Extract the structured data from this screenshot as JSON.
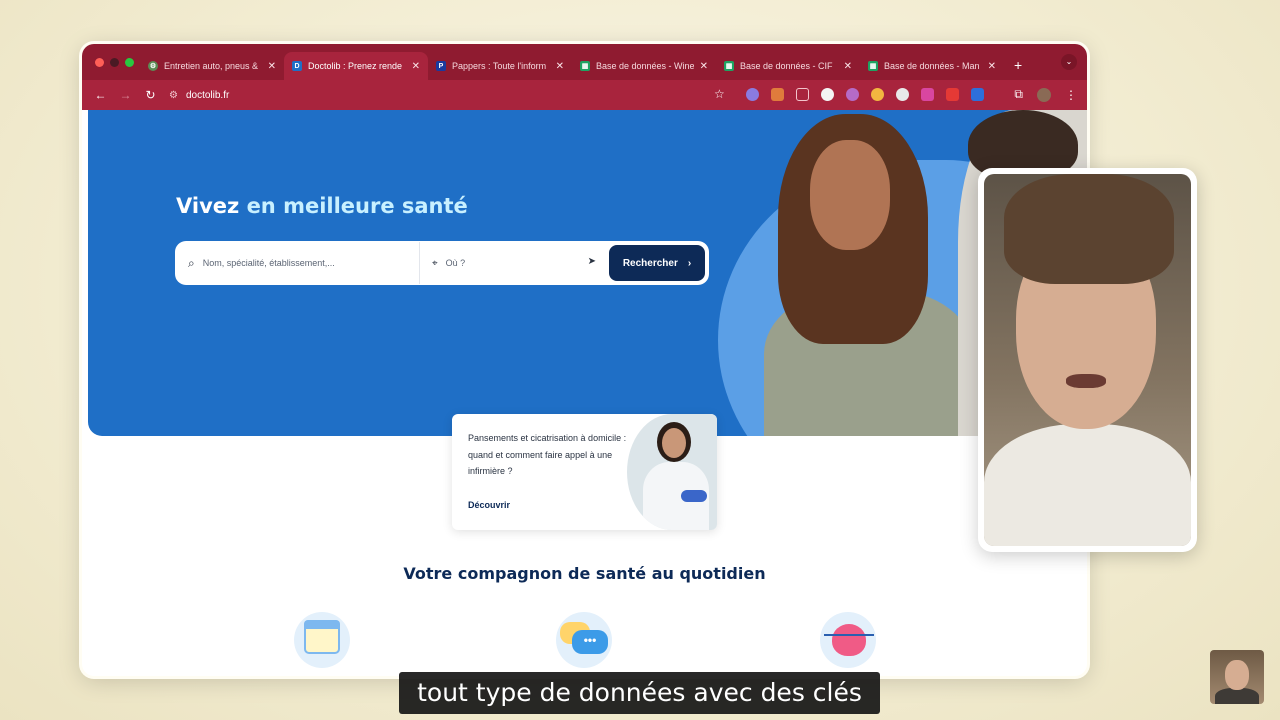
{
  "browser": {
    "tabs": [
      {
        "title": "Entretien auto, pneus &",
        "favicon": "gear-icon",
        "active": false
      },
      {
        "title": "Doctolib : Prenez rende",
        "favicon": "doctolib-icon",
        "active": true
      },
      {
        "title": "Pappers : Toute l'inform",
        "favicon": "pappers-icon",
        "active": false
      },
      {
        "title": "Base de données - Wine",
        "favicon": "sheets-icon",
        "active": false
      },
      {
        "title": "Base de données - CIF",
        "favicon": "sheets-icon",
        "active": false
      },
      {
        "title": "Base de données - Man",
        "favicon": "sheets-icon",
        "active": false
      }
    ],
    "new_tab": "+",
    "url": "doctolib.fr",
    "colors": {
      "tabbar": "#8f1b30",
      "toolbar": "#a8243d"
    }
  },
  "hero": {
    "title_part1": "Vivez",
    "title_part2": "en meilleure santé",
    "search_placeholder": "Nom, spécialité, établissement,...",
    "location_placeholder": "Où ?",
    "search_button": "Rechercher",
    "accent_color": "#1f6fc6"
  },
  "promo_card": {
    "text": "Pansements et cicatrisation à domicile : quand et comment faire appel à une infirmière ?",
    "cta": "Découvrir"
  },
  "section": {
    "title": "Votre compagnon de santé au quotidien"
  },
  "caption": {
    "text": "tout type de données avec des clés"
  }
}
